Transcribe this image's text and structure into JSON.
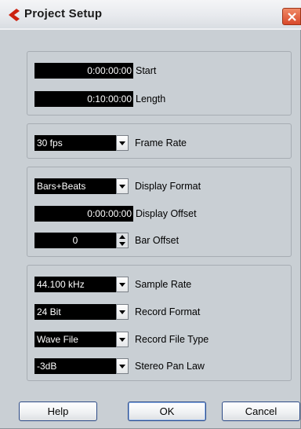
{
  "window": {
    "title": "Project Setup",
    "icon": "cubase-logo-icon",
    "close_icon": "close-icon",
    "close_color": "#d8482a"
  },
  "time": {
    "start_value": "0:00:00:00",
    "start_label": "Start",
    "length_value": "0:10:00:00",
    "length_label": "Length"
  },
  "frame": {
    "rate_value": "30 fps",
    "rate_label": "Frame Rate"
  },
  "display": {
    "format_value": "Bars+Beats",
    "format_label": "Display Format",
    "offset_value": "0:00:00:00",
    "offset_label": "Display Offset",
    "bar_offset_value": "0",
    "bar_offset_label": "Bar Offset"
  },
  "audio": {
    "sample_rate_value": "44.100 kHz",
    "sample_rate_label": "Sample Rate",
    "record_format_value": "24 Bit",
    "record_format_label": "Record Format",
    "file_type_value": "Wave File",
    "file_type_label": "Record File Type",
    "pan_law_value": "-3dB",
    "pan_law_label": "Stereo Pan Law"
  },
  "buttons": {
    "help": "Help",
    "ok": "OK",
    "cancel": "Cancel"
  }
}
